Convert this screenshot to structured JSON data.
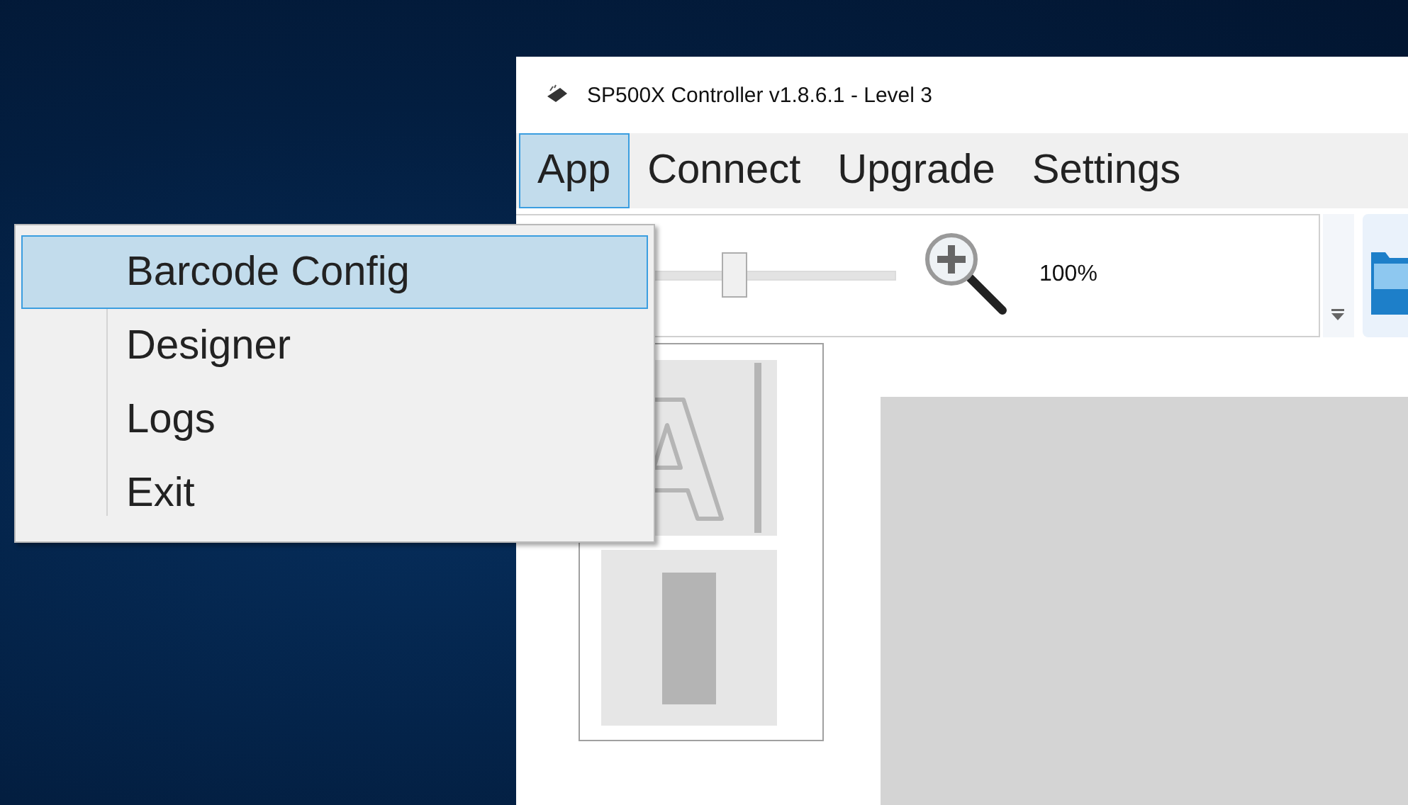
{
  "window": {
    "title": "SP500X Controller v1.8.6.1 - Level 3"
  },
  "menu_bar": [
    {
      "label": "App",
      "selected": true
    },
    {
      "label": "Connect",
      "selected": false
    },
    {
      "label": "Upgrade",
      "selected": false
    },
    {
      "label": "Settings",
      "selected": false
    }
  ],
  "app_menu": [
    {
      "label": "Barcode Config",
      "selected": true
    },
    {
      "label": "Designer",
      "selected": false
    },
    {
      "label": "Logs",
      "selected": false
    },
    {
      "label": "Exit",
      "selected": false
    }
  ],
  "toolbar": {
    "zoom_slider": {
      "level": 0.5
    },
    "zoom_reading": "100%"
  }
}
